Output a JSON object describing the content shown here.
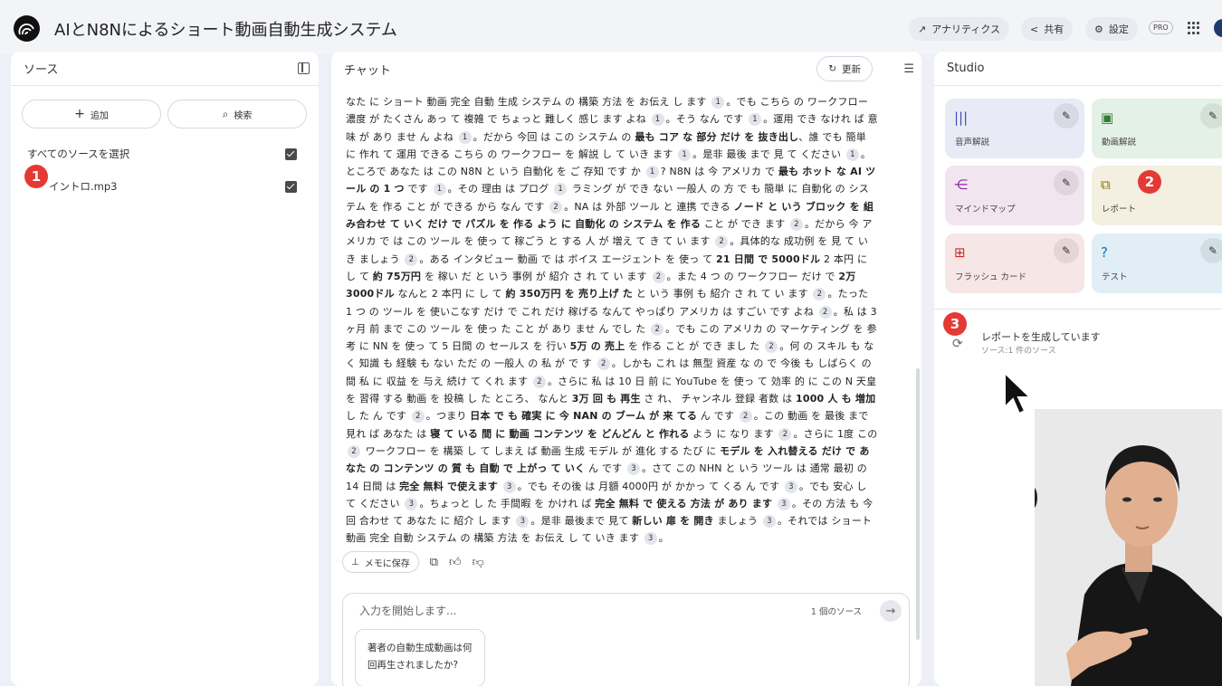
{
  "app": {
    "title": "AIとN8Nによるショート動画自動生成システム",
    "buttons": {
      "analytics": "アナリティクス",
      "share": "共有",
      "settings": "設定",
      "pro": "PRO"
    }
  },
  "sources": {
    "header": "ソース",
    "add_label": "追加",
    "search_label": "検索",
    "select_all_label": "すべてのソースを選択",
    "items": [
      {
        "name": "イントロ.mp3",
        "checked": true
      }
    ]
  },
  "chat": {
    "header": "チャット",
    "refresh_label": "更新",
    "paragraph": [
      {
        "t": "なた に ショート 動画 完全 自動 生成 システム の 構築 方法 を お伝え し ます "
      },
      {
        "c": "1"
      },
      {
        "t": "。でも こちら の ワークフロー 濃度 が たくさん あっ て 複雑 で ちょっと 難しく 感じ ます よね "
      },
      {
        "c": "1"
      },
      {
        "t": "。そう なん です "
      },
      {
        "c": "1"
      },
      {
        "t": "。運用 でき なけれ ば 意味 が あり ませ ん よね "
      },
      {
        "c": "1"
      },
      {
        "t": "。だから 今回 は この システム の "
      },
      {
        "b": "最も コア な 部分 だけ を 抜き出し"
      },
      {
        "t": "、誰 でも 簡単 に 作れ て 運用 できる こちら の ワークフロー を 解説 し て いき ます "
      },
      {
        "c": "1"
      },
      {
        "t": "。是非 最後 まで 見 て ください "
      },
      {
        "c": "1"
      },
      {
        "t": "。ところで あなた は この N8N と いう 自動化 を ご 存知 です か "
      },
      {
        "c": "1"
      },
      {
        "t": "? N8N は 今 アメリカ で "
      },
      {
        "b": "最も ホット な AI ツール の 1 つ"
      },
      {
        "t": " です "
      },
      {
        "c": "1"
      },
      {
        "t": "。その 理由 は プログ "
      },
      {
        "c": "1"
      },
      {
        "t": " ラミング が でき ない 一般人 の 方 で も 簡単 に 自動化 の システム を 作る こと が できる から なん です "
      },
      {
        "c": "2"
      },
      {
        "t": "。NA は 外部 ツール と 連携 できる "
      },
      {
        "b": "ノード と いう ブロック を 組み合わせ て いく だけ で パズル を 作る よう に 自動化 の システム を 作る"
      },
      {
        "t": " こと が でき ます "
      },
      {
        "c": "2"
      },
      {
        "t": "。だから 今 アメリカ で は この ツール を 使っ て 稼ごう と する 人 が 増え て き て い ます "
      },
      {
        "c": "2"
      },
      {
        "t": "。具体的な 成功例 を 見 て いき ましょう "
      },
      {
        "c": "2"
      },
      {
        "t": "。ある インタビュー 動画 で は ボイス エージェント を 使っ て "
      },
      {
        "b": "21 日間 で 5000ドル"
      },
      {
        "t": " 2 本円 に し て "
      },
      {
        "b": "約 75万円"
      },
      {
        "t": " を 稼い だ と いう 事例 が 紹介 さ れ て い ます "
      },
      {
        "c": "2"
      },
      {
        "t": "。また 4 つ の ワークフロー だけ で "
      },
      {
        "b": "2万3000ドル"
      },
      {
        "t": " なんと 2 本円 に し て "
      },
      {
        "b": "約 350万円 を 売り上げ た"
      },
      {
        "t": " と いう 事例 も 紹介 さ れ て い ます "
      },
      {
        "c": "2"
      },
      {
        "t": "。たった 1 つ の ツール を 使いこなす だけ で これ だけ 稼げる なんて やっぱり アメリカ は すごい です よね "
      },
      {
        "c": "2"
      },
      {
        "t": "。私 は 3 ヶ月 前 まで この ツール を 使っ た こと が あり ませ ん でし た "
      },
      {
        "c": "2"
      },
      {
        "t": "。でも この アメリカ の マーケティング を 参考 に NN を 使っ て 5 日間 の セールス を 行い "
      },
      {
        "b": "5万 の 売上"
      },
      {
        "t": " を 作る こと が でき まし た "
      },
      {
        "c": "2"
      },
      {
        "t": "。何 の スキル も なく 知識 も 経験 も ない ただ の 一般人 の 私 が で す "
      },
      {
        "c": "2"
      },
      {
        "t": "。しかも これ は 無型 資産 な の で 今後 も しばらく の 間 私 に 収益 を 与え 続け て くれ ます "
      },
      {
        "c": "2"
      },
      {
        "t": "。さらに 私 は 10 日 前 に YouTube を 使っ て 効率 的 に この N 天皇 を 習得 する 動画 を 投稿 し た ところ、 なんと "
      },
      {
        "b": "3万 回 も 再生"
      },
      {
        "t": " さ れ、 チャンネル 登録 者数 は "
      },
      {
        "b": "1000 人 も 増加"
      },
      {
        "t": " し た ん です "
      },
      {
        "c": "2"
      },
      {
        "t": "。つまり "
      },
      {
        "b": "日本 で も 確実 に 今 NAN の ブーム が 来 てる"
      },
      {
        "t": " ん です "
      },
      {
        "c": "2"
      },
      {
        "t": "。この 動画 を 最後 まで 見れ ば あなた は "
      },
      {
        "b": "寝 て いる 間 に 動画 コンテンツ を どんどん と 作れる"
      },
      {
        "t": " よう に なり ます "
      },
      {
        "c": "2"
      },
      {
        "t": "。さらに 1度 この "
      },
      {
        "c": "2"
      },
      {
        "t": " ワークフロー を 構築 し て しまえ ば 動画 生成 モデル が 進化 する たび に "
      },
      {
        "b": "モデル を 入れ替える だけ で あなた の コンテンツ の 質 も 自動 で 上がっ て いく"
      },
      {
        "t": " ん です "
      },
      {
        "c": "3"
      },
      {
        "t": "。さて この NHN と いう ツール は 通常 最初 の 14 日間 は "
      },
      {
        "b": "完全 無料 で使えます"
      },
      {
        "t": " "
      },
      {
        "c": "3"
      },
      {
        "t": "。でも その後 は 月額 4000円 が かかっ て くる ん です "
      },
      {
        "c": "3"
      },
      {
        "t": "。でも 安心 し て ください "
      },
      {
        "c": "3"
      },
      {
        "t": "。ちょっと し た 手間暇 を かけれ ば "
      },
      {
        "b": "完全 無料 で 使える 方法 が あり ます"
      },
      {
        "t": " "
      },
      {
        "c": "3"
      },
      {
        "t": "。その 方法 も 今回 合わせ て あなた に 紹介 し ます "
      },
      {
        "c": "3"
      },
      {
        "t": "。是非 最後まで 見て "
      },
      {
        "b": "新しい 扉 を 開き"
      },
      {
        "t": " ましょう "
      },
      {
        "c": "3"
      },
      {
        "t": "。それでは ショート 動画 完全 自動 システム の 構築 方法 を お伝え し て いき ます "
      },
      {
        "c": "3"
      },
      {
        "t": "。"
      }
    ],
    "save_note_label": "メモに保存",
    "input_placeholder": "入力を開始します...",
    "source_count": "1 個のソース",
    "suggestion": "著者の自動生成動画は何回再生されましたか?"
  },
  "studio": {
    "header": "Studio",
    "tiles": [
      {
        "label": "音声解説",
        "icon": "audio-icon",
        "bg": "#e8eaf6",
        "color": "#3f51b5"
      },
      {
        "label": "動画解説",
        "icon": "video-icon",
        "bg": "#e4f1e6",
        "color": "#2e7d32"
      },
      {
        "label": "マインドマップ",
        "icon": "mindmap-icon",
        "bg": "#f1e6f0",
        "color": "#8e24aa"
      },
      {
        "label": "レポート",
        "icon": "report-icon",
        "bg": "#f3efe1",
        "color": "#8d6e00"
      },
      {
        "label": "フラッシュ カード",
        "icon": "flashcard-icon",
        "bg": "#f7e6e6",
        "color": "#c62828"
      },
      {
        "label": "テスト",
        "icon": "quiz-icon",
        "bg": "#e1eef6",
        "color": "#0277bd"
      }
    ],
    "generating_title": "レポートを生成しています",
    "generating_sub": "ソース:1 件のソース"
  },
  "markers": [
    "1",
    "2",
    "3"
  ]
}
